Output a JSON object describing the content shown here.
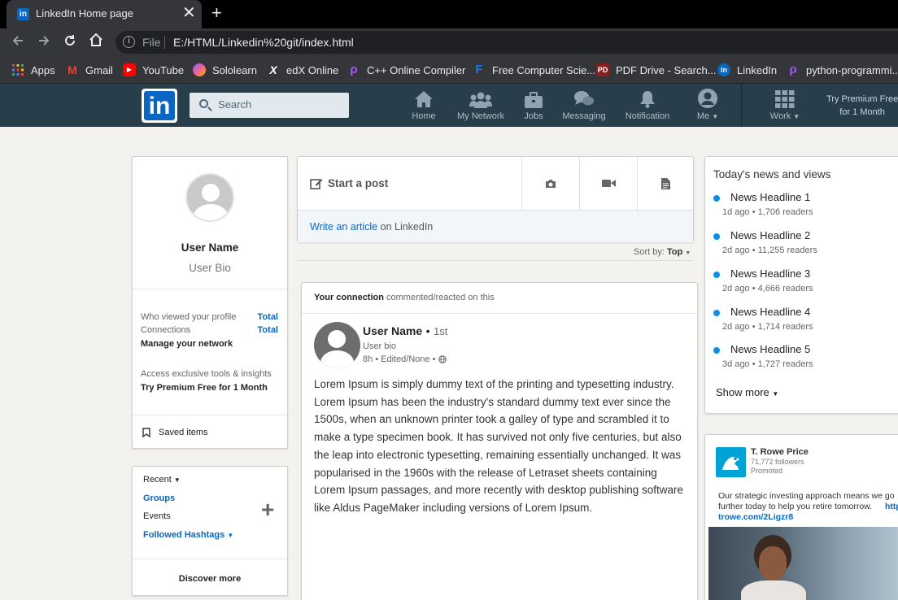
{
  "browser": {
    "tab_title": "LinkedIn Home page",
    "tab_close": "✕",
    "new_tab": "+",
    "scheme_label": "File",
    "url": "E:/HTML/Linkedin%20git/index.html",
    "bookmarks": [
      {
        "label": "Apps",
        "icon": "apps-grid-icon",
        "color": "#ea4335"
      },
      {
        "label": "Gmail",
        "icon": "gmail-icon",
        "color": "#ea4335"
      },
      {
        "label": "YouTube",
        "icon": "youtube-icon",
        "color": "#ff0000"
      },
      {
        "label": "Sololearn",
        "icon": "sololearn-icon",
        "color": "#7b61ff"
      },
      {
        "label": "edX Online",
        "icon": "edx-icon",
        "color": "#222222"
      },
      {
        "label": "C++ Online Compiler",
        "icon": "compiler-icon",
        "color": "#7b3fe4"
      },
      {
        "label": "Free Computer Scie...",
        "icon": "f-icon",
        "color": "#1a73e8"
      },
      {
        "label": "PDF Drive - Search...",
        "icon": "pdf-drive-icon",
        "color": "#c62828"
      },
      {
        "label": "LinkedIn",
        "icon": "linkedin-icon",
        "color": "#0a66c2"
      },
      {
        "label": "python-programmi...",
        "icon": "python-icon",
        "color": "#7b3fe4"
      }
    ]
  },
  "header": {
    "logo_text": "in",
    "search_placeholder": "Search",
    "nav": [
      {
        "label": "Home",
        "icon": "home-icon"
      },
      {
        "label": "My Network",
        "icon": "network-icon"
      },
      {
        "label": "Jobs",
        "icon": "briefcase-icon"
      },
      {
        "label": "Messaging",
        "icon": "messaging-icon"
      },
      {
        "label": "Notification",
        "icon": "bell-icon"
      },
      {
        "label": "Me",
        "icon": "avatar-icon"
      },
      {
        "label": "Work",
        "icon": "grid-icon"
      }
    ],
    "premium_line1": "Try Premium Free",
    "premium_line2": "for 1 Month",
    "colors": {
      "bar": "#283e4a",
      "brand": "#0a66c2"
    }
  },
  "profile": {
    "name": "User Name",
    "bio": "User Bio",
    "viewed_label": "Who viewed your profile",
    "viewed_value": "Total",
    "connections_label": "Connections",
    "connections_value": "Total",
    "manage": "Manage your network",
    "exclusive": "Access exclusive tools & insights",
    "premium": "Try Premium Free for 1 Month",
    "saved": "Saved items"
  },
  "groups_card": {
    "recent": "Recent",
    "groups": "Groups",
    "events": "Events",
    "hashtags": "Followed Hashtags",
    "plus": "+",
    "discover": "Discover more"
  },
  "composer": {
    "start_post": "Start a post",
    "write_article": "Write an article",
    "on_linkedin": "on LinkedIn",
    "sort_label": "Sort by:",
    "sort_value": "Top"
  },
  "post": {
    "context_bold": "Your connection",
    "context_rest": "commented/reacted on this",
    "author": "User Name",
    "degree": "1st",
    "author_bio": "User bio",
    "time": "8h",
    "edited": "Edited/None",
    "body": "Lorem Ipsum is simply dummy text of the printing and typesetting industry. Lorem Ipsum has been the industry's standard dummy text ever since the 1500s, when an unknown printer took a galley of type and scrambled it to make a type specimen book. It has survived not only five centuries, but also the leap into electronic typesetting, remaining essentially unchanged. It was popularised in the 1960s with the release of Letraset sheets containing Lorem Ipsum passages, and more recently with desktop publishing software like Aldus PageMaker including versions of Lorem Ipsum."
  },
  "news": {
    "title": "Today's news and views",
    "items": [
      {
        "headline": "News Headline 1",
        "ago": "1d ago",
        "readers": "1,706 readers"
      },
      {
        "headline": "News Headline 2",
        "ago": "2d ago",
        "readers": "11,255 readers"
      },
      {
        "headline": "News Headline 3",
        "ago": "2d ago",
        "readers": "4,666 readers"
      },
      {
        "headline": "News Headline 4",
        "ago": "2d ago",
        "readers": "1,714 readers"
      },
      {
        "headline": "News Headline 5",
        "ago": "3d ago",
        "readers": "1,727 readers"
      }
    ],
    "show_more": "Show more"
  },
  "ad": {
    "company": "T. Rowe Price",
    "followers": "71,772 followers",
    "promoted": "Promoted",
    "text": "Our strategic investing approach means we go further today to help you retire tomorrow.",
    "link": "trowe.com/2Ligzr8",
    "link_prefix": "http"
  }
}
